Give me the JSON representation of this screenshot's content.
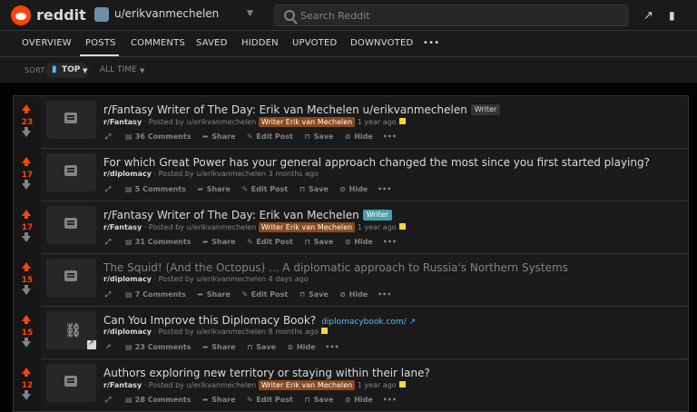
{
  "app": {
    "brand": "reddit",
    "username": "u/erikvanmechelen"
  },
  "search": {
    "placeholder": "Search Reddit"
  },
  "tabs": [
    {
      "label": "OVERVIEW"
    },
    {
      "label": "POSTS"
    },
    {
      "label": "COMMENTS"
    },
    {
      "label": "SAVED"
    },
    {
      "label": "HIDDEN"
    },
    {
      "label": "UPVOTED"
    },
    {
      "label": "DOWNVOTED"
    },
    {
      "label": "•••"
    }
  ],
  "sort": {
    "label": "SORT",
    "value": "TOP",
    "time": "ALL TIME"
  },
  "colors": {
    "accent": "#ff4500",
    "link": "#4fbcff",
    "bg": "#1a1a1b"
  },
  "posts": [
    {
      "score": "23",
      "title": "r/Fantasy Writer of The Day: Erik van Mechelen u/erikvanmechelen",
      "flair": "Writer",
      "sub": "r/Fantasy",
      "posted": "· Posted by u/erikvanmechelen",
      "user_flair": "Writer Erik van Mechelen",
      "time": "1 year ago",
      "comments": "36 Comments",
      "share": "Share",
      "edit": "Edit Post",
      "save": "Save",
      "hide": "Hide",
      "more": "•••"
    },
    {
      "score": "17",
      "title": "For which Great Power has your general approach changed the most since you first started playing?",
      "sub": "r/diplomacy",
      "posted": "· Posted by u/erikvanmechelen 3 months ago",
      "comments": "5 Comments",
      "share": "Share",
      "edit": "Edit Post",
      "save": "Save",
      "hide": "Hide",
      "more": "•••"
    },
    {
      "score": "17",
      "title": "r/Fantasy Writer of The Day: Erik van Mechelen",
      "flair": "Writer",
      "sub": "r/Fantasy",
      "posted": "· Posted by u/erikvanmechelen",
      "user_flair": "Writer Erik van Mechelen",
      "time": "1 year ago",
      "comments": "31 Comments",
      "share": "Share",
      "edit": "Edit Post",
      "save": "Save",
      "hide": "Hide",
      "more": "•••"
    },
    {
      "score": "15",
      "title": "The Squid! (And the Octopus) ... A diplomatic approach to Russia's Northern Systems",
      "sub": "r/diplomacy",
      "posted": "· Posted by u/erikvanmechelen 4 days ago",
      "comments": "7 Comments",
      "share": "Share",
      "edit": "Edit Post",
      "save": "Save",
      "hide": "Hide",
      "more": "•••"
    },
    {
      "score": "15",
      "title": "Can You Improve this Diplomacy Book?",
      "domain": "diplomacybook.com/ ↗",
      "sub": "r/diplomacy",
      "posted": "· Posted by u/erikvanmechelen 8 months ago",
      "comments": "23 Comments",
      "share": "Share",
      "save": "Save",
      "hide": "Hide",
      "more": "•••"
    },
    {
      "score": "12",
      "title": "Authors exploring new territory or staying within their lane?",
      "sub": "r/Fantasy",
      "posted": "· Posted by u/erikvanmechelen",
      "user_flair": "Writer Erik van Mechelen",
      "time": "1 year ago",
      "comments": "28 Comments",
      "share": "Share",
      "edit": "Edit Post",
      "save": "Save",
      "hide": "Hide",
      "more": "•••"
    }
  ]
}
